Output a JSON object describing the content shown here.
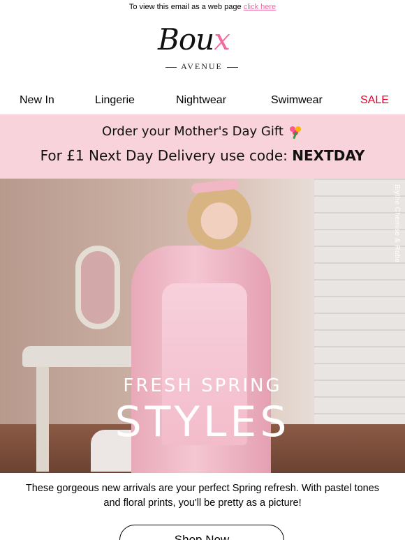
{
  "preheader": {
    "text": "To view this email as a web page",
    "link": "click here"
  },
  "logo": {
    "script_main": "Bou",
    "script_x": "x",
    "sub": "AVENUE"
  },
  "nav": {
    "new_in": "New  In",
    "lingerie": "Lingerie",
    "nightwear": "Nightwear",
    "swimwear": "Swimwear",
    "sale": "SALE"
  },
  "promo": {
    "line1": "Order your Mother's Day Gift",
    "line2_prefix": "For £1 Next Day Delivery use code:",
    "line2_code": "NEXTDAY",
    "icon": "bouquet-icon"
  },
  "hero": {
    "caption": "Blythe Chemise & Robe",
    "title_small": "FRESH SPRING",
    "title_large": "STYLES"
  },
  "body": {
    "copy": "These gorgeous new arrivals are your perfect Spring refresh. With pastel tones and floral prints, you'll be pretty as a picture!"
  },
  "cta": {
    "label": "Shop Now"
  },
  "colors": {
    "promo_bg": "#f9d3dc",
    "sale": "#e4002b",
    "link": "#f06aa0"
  }
}
